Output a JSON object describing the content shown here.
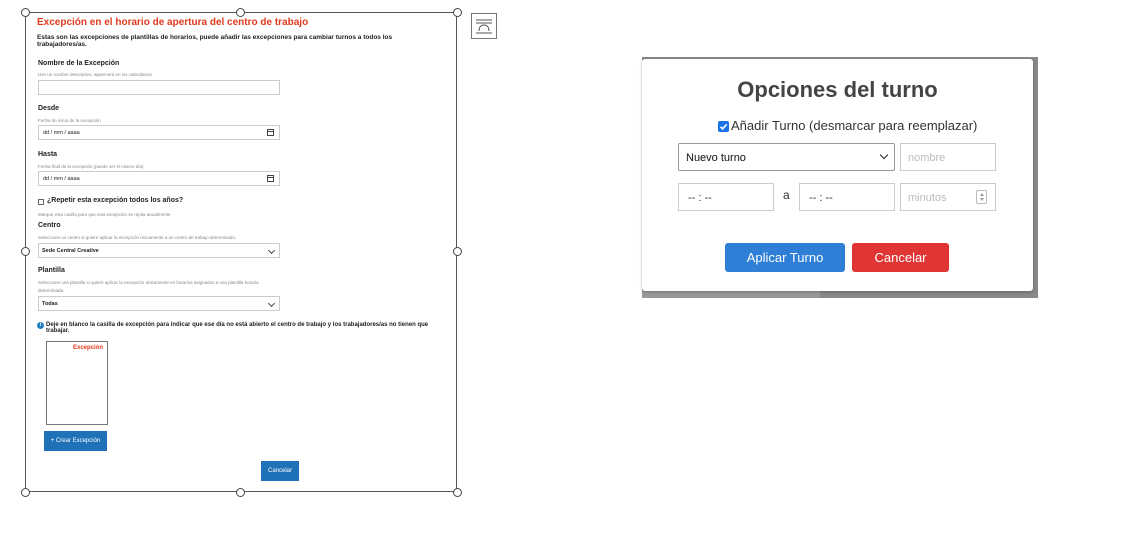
{
  "exception_form": {
    "title": "Excepción en el horario de apertura del centro de trabajo",
    "intro": "Estas son las excepciones de plantillas de horarios, puede añadir las excepciones para cambiar turnos a todos los trabajadores/as.",
    "name": {
      "label": "Nombre de la Excepción",
      "hint": "Use un nombre descriptivo, aparecerá en los calendarios",
      "value": ""
    },
    "from": {
      "label": "Desde",
      "hint": "Fecha de inicio de la excepción",
      "value": "dd / mm / aaaa"
    },
    "to": {
      "label": "Hasta",
      "hint": "Fecha final de la excepción (puede ser el mismo día)",
      "value": "dd / mm / aaaa"
    },
    "repeat": {
      "label": "¿Repetir esta excepción todos los años?",
      "hint": "Marque esta casilla para que esta excepción se repita anualmente",
      "checked": false
    },
    "center": {
      "label": "Centro",
      "hint": "Seleccione un centro si quiere aplicar la excepción únicamente a un centro de trabajo determinado.",
      "value": "Sede Central Creative"
    },
    "template": {
      "label": "Plantilla",
      "hint_line1": "Seleccione una plantilla si quiere aplicar la excepción únicamente en horarios asignados a una plantilla horaria",
      "hint_line2": "determinada.",
      "value": "Todas"
    },
    "note": "Deje en blanco la casilla de excepción para indicar que ese día no está abierto el centro de trabajo y los trabajadores/as no tienen que trabajar.",
    "note_icon": "info-icon",
    "preview_label": "Excepción",
    "create_button": "+ Crear Excepción",
    "cancel_button": "Cancelar",
    "accent_color": "#e03a1e",
    "button_color": "#1f72b8"
  },
  "shift_dialog": {
    "title": "Opciones del turno",
    "add_shift": {
      "label": "Añadir Turno (desmarcar para reemplazar)",
      "checked": true
    },
    "shift_select": {
      "value": "Nuevo turno"
    },
    "name_input": {
      "placeholder": "nombre"
    },
    "start_time": {
      "value": "-- : --"
    },
    "separator": "a",
    "end_time": {
      "value": "-- : --"
    },
    "minutes_input": {
      "placeholder": "minutos"
    },
    "apply_button": "Aplicar Turno",
    "cancel_button": "Cancelar",
    "apply_color": "#2f7fd6",
    "cancel_color": "#e03535"
  }
}
